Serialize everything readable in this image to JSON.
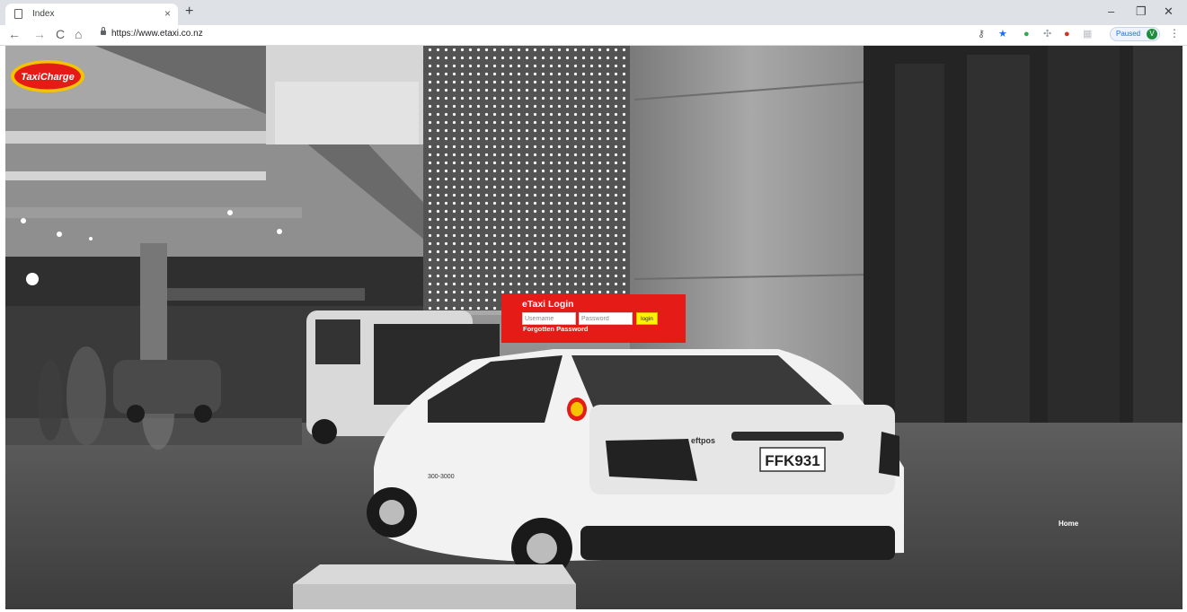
{
  "browser": {
    "tab_title": "Index",
    "tab_close": "×",
    "new_tab": "+",
    "url": "https://www.etaxi.co.nz",
    "minimize": "–",
    "restore": "❐",
    "close": "✕",
    "back": "←",
    "forward": "→",
    "reload": "C",
    "home": "⌂",
    "paused_label": "Paused",
    "profile_initial": "V",
    "menu": "⋮"
  },
  "header": {
    "logo_text": "TaxiCharge",
    "brand_colors": {
      "logo_red": "#e41b17",
      "logo_yellow": "#f5c400"
    }
  },
  "login": {
    "title": "eTaxi Login",
    "username_placeholder": "Username",
    "password_placeholder": "Password",
    "button_label": "login",
    "forgot_label": "Forgotten Password",
    "box_color": "#e41b17",
    "button_color": "#fff200"
  },
  "nav": {
    "home_label": "Home"
  },
  "background": {
    "taxi_plate": "FFK931",
    "taxi_badge": "eftpos",
    "taxi_side_number": "300-3000"
  }
}
